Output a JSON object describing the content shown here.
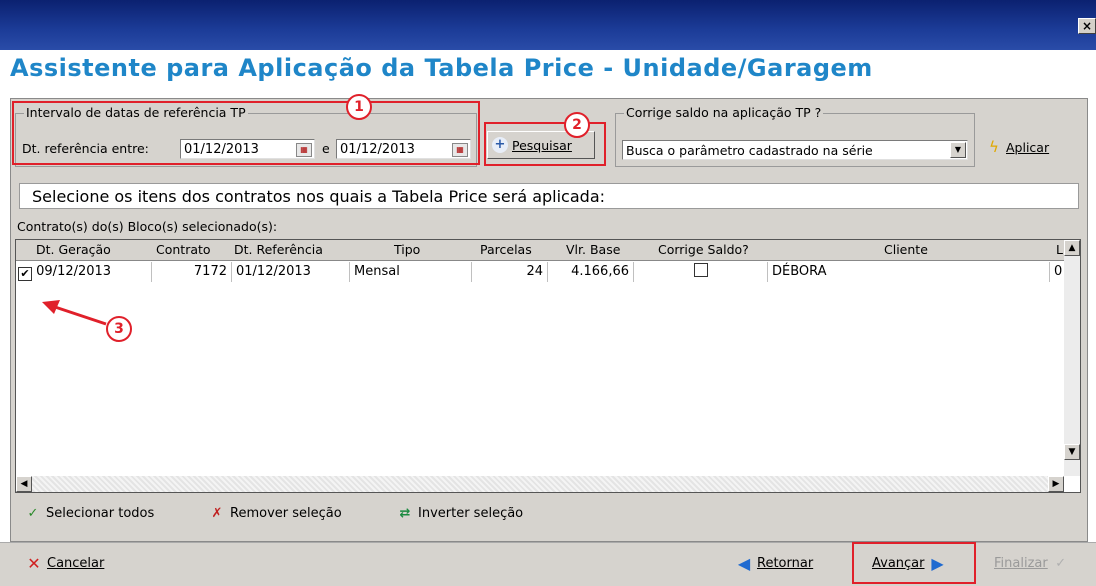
{
  "window": {
    "close_glyph": "×"
  },
  "heading": "Assistente para Aplicação da Tabela Price - Unidade/Garagem",
  "date_group": {
    "title": "Intervalo de datas de referência TP",
    "label": "Dt. referência entre:",
    "start": "01/12/2013",
    "sep": "e",
    "end": "01/12/2013"
  },
  "search": {
    "label": "Pesquisar"
  },
  "correction": {
    "title": "Corrige saldo na aplicação TP ?",
    "selected": "Busca o parâmetro cadastrado na série",
    "apply_label": "Aplicar"
  },
  "info_text": "Selecione os itens dos contratos nos quais a Tabela Price será aplicada:",
  "grid_caption": "Contrato(s) do(s) Bloco(s) selecionado(s):",
  "grid": {
    "columns": [
      "Dt. Geração",
      "Contrato",
      "Dt. Referência",
      "Tipo",
      "Parcelas",
      "Vlr. Base",
      "Corrige Saldo?",
      "Cliente",
      "L"
    ],
    "rows": [
      {
        "checked": true,
        "dt_geracao": "09/12/2013",
        "contrato": "7172",
        "dt_referencia": "01/12/2013",
        "tipo": "Mensal",
        "parcelas": "24",
        "vlr_base": "4.166,66",
        "corrige_saldo": false,
        "cliente": "DÉBORA",
        "l": "0"
      }
    ]
  },
  "selection_actions": {
    "select_all": "Selecionar todos",
    "remove": "Remover seleção",
    "invert": "Inverter seleção"
  },
  "footer": {
    "cancel": "Cancelar",
    "back": "Retornar",
    "next": "Avançar",
    "finish": "Finalizar"
  },
  "annotations": [
    "1",
    "2",
    "3"
  ],
  "colors": {
    "heading": "#1f86c8",
    "highlight": "#e0202a",
    "titlebar": "#0b2170"
  }
}
